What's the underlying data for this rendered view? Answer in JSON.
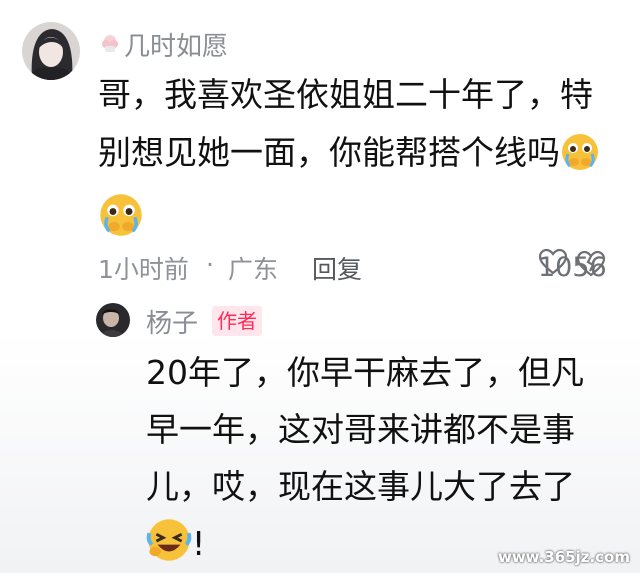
{
  "comment": {
    "username": "几时如愿",
    "text_part1": "哥，我喜欢圣依姐姐二十年了，特别想见她一面，你能帮搭个线吗",
    "time": "1小时前",
    "location_sep": "·",
    "location": "广东",
    "reply_label": "回复",
    "like_count": "1056",
    "emoji_name": "pleading-face-emoji"
  },
  "reply": {
    "username": "杨子",
    "badge": "作者",
    "text": "20年了，你早干麻去了，但凡早一年，这对哥来讲都不是事儿，哎，现在这事儿大了去了",
    "suffix": "!",
    "emoji_name": "laughing-crying-face-emoji"
  },
  "watermark": "www.365jz.com",
  "colors": {
    "meta_gray": "#8f9297",
    "badge_red": "#ff2a55",
    "badge_bg": "#ffe6ec",
    "emoji_yellow": "#f7c23a"
  }
}
